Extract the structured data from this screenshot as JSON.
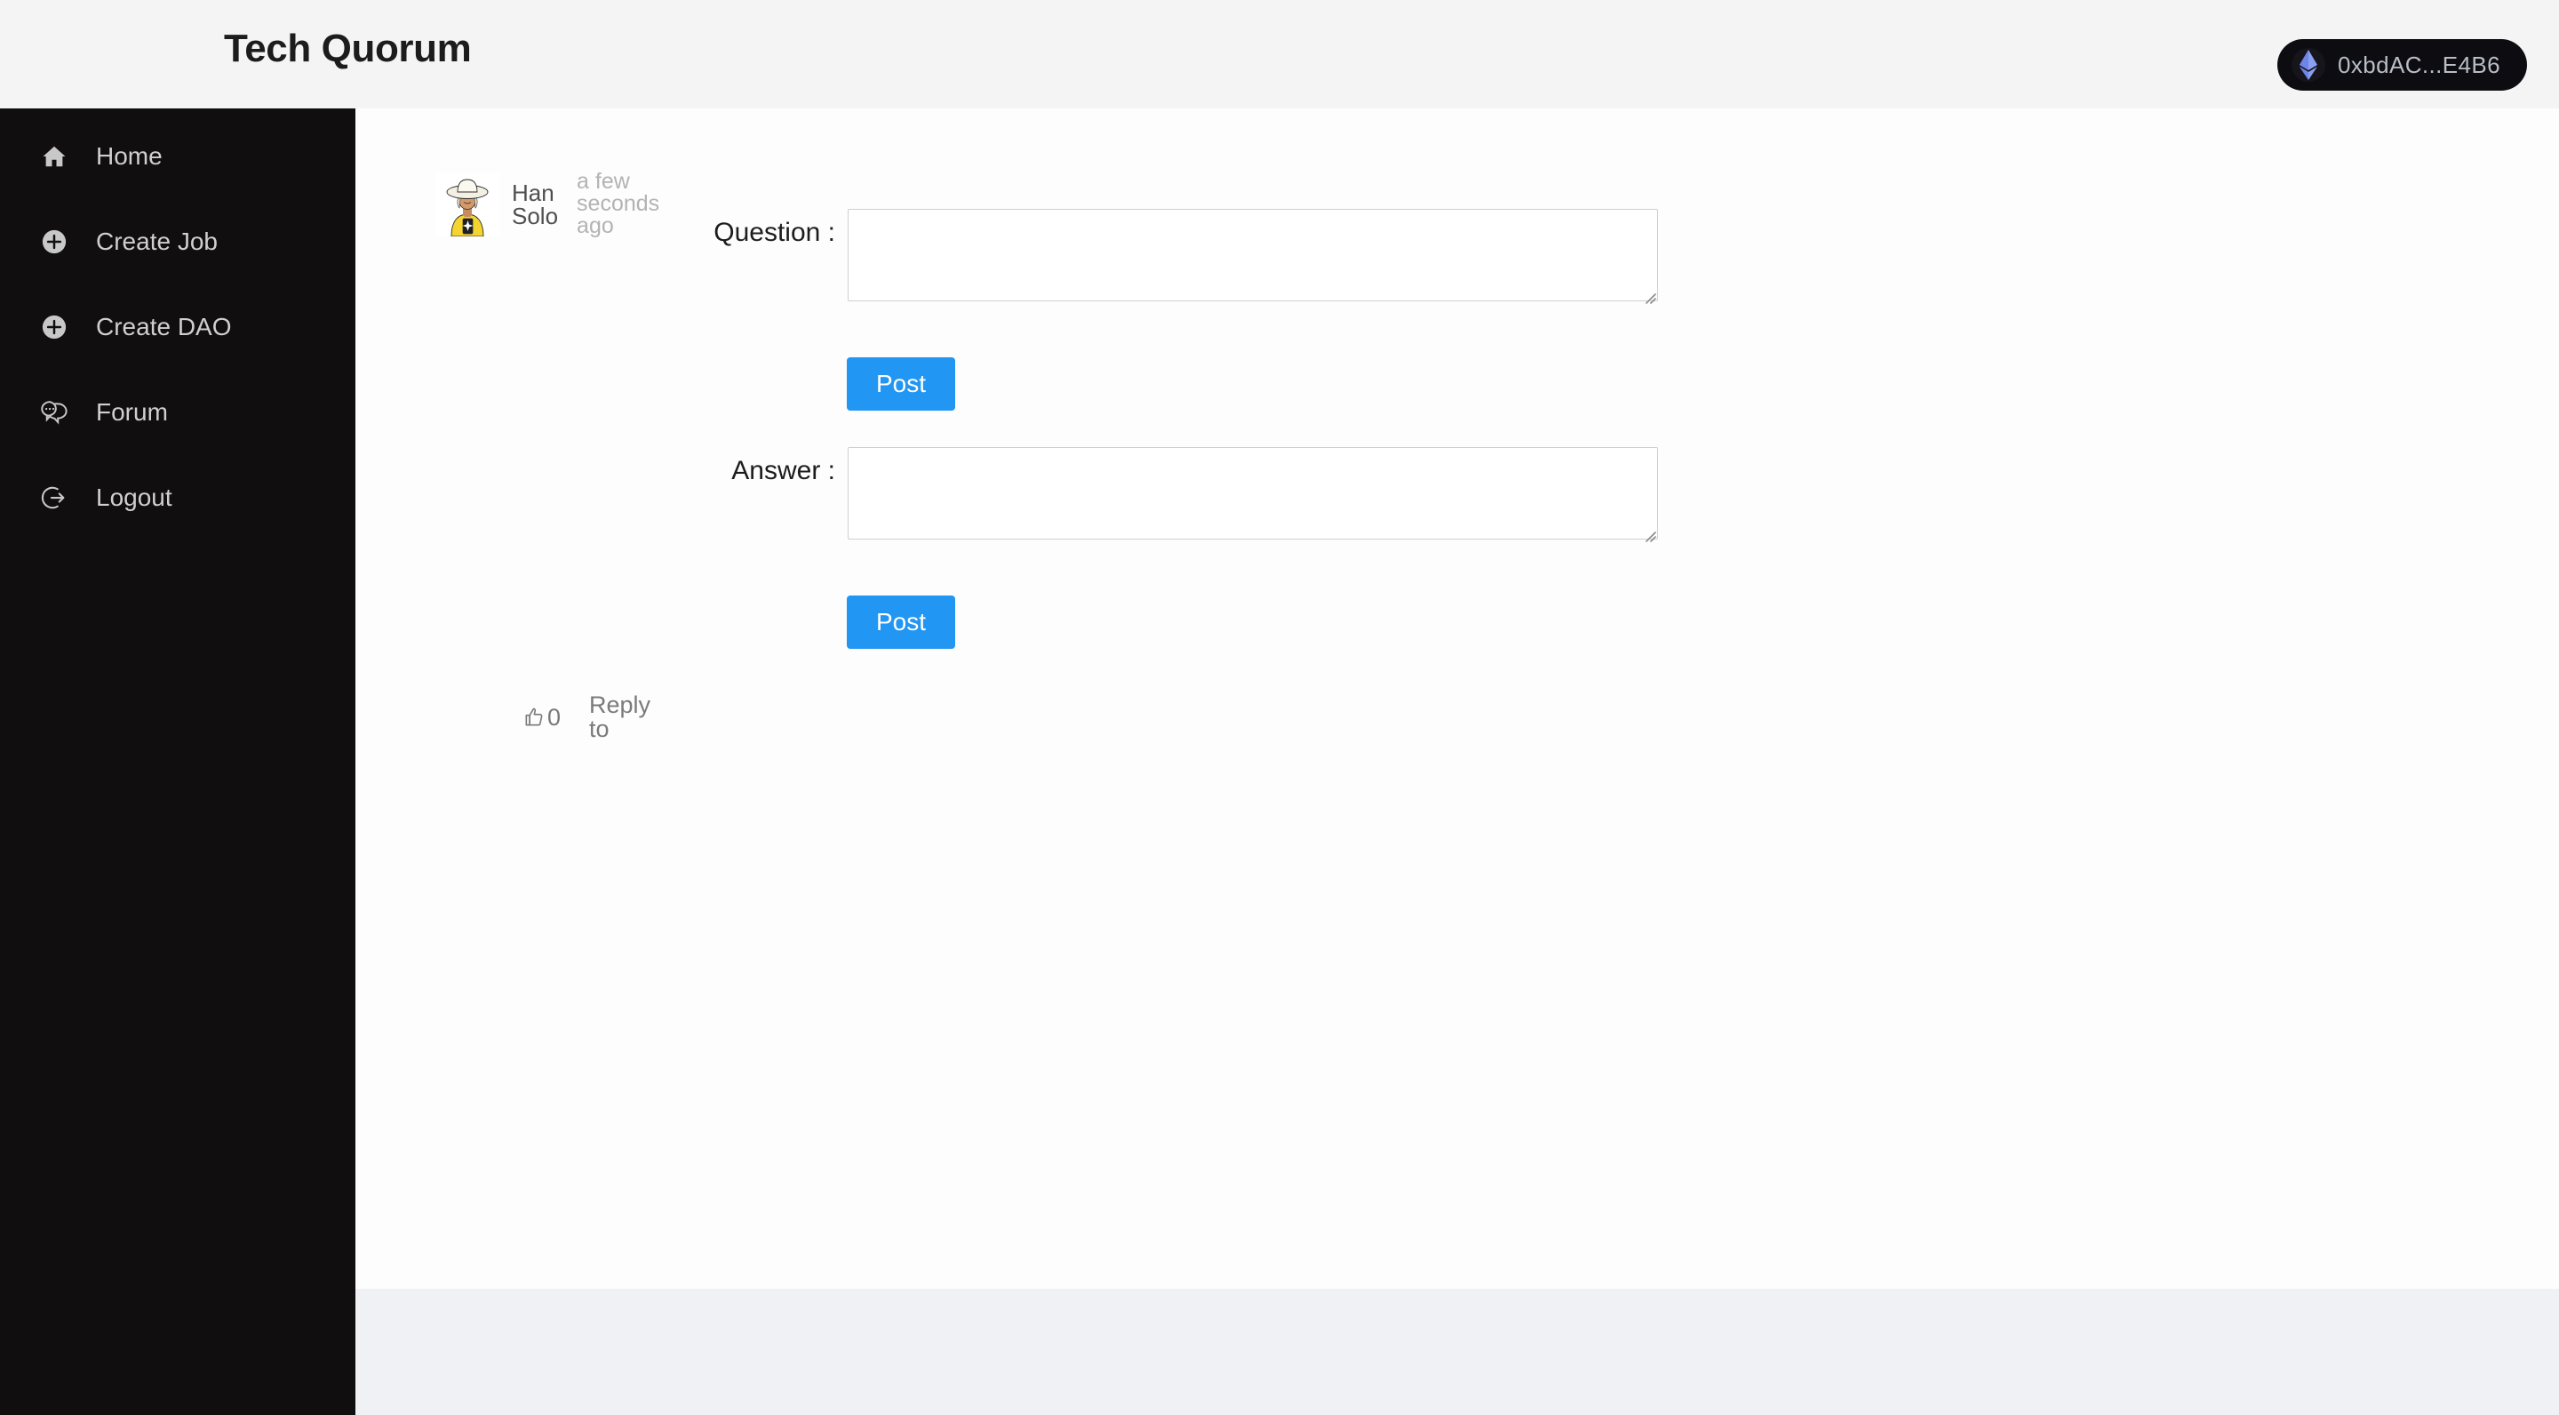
{
  "header": {
    "brand_title": "Tech Quorum",
    "wallet": {
      "address": "0xbdAC...E4B6",
      "icon": "ethereum-diamond-icon",
      "background_color": "#0d0d11",
      "text_color": "#b9bdc6"
    },
    "background_color": "#f4f4f4"
  },
  "sidebar": {
    "background_color": "#100e0e",
    "text_color": "#cfcfcf",
    "items": [
      {
        "label": "Home",
        "icon": "home-icon"
      },
      {
        "label": "Create Job",
        "icon": "plus-circle-icon"
      },
      {
        "label": "Create DAO",
        "icon": "plus-circle-icon"
      },
      {
        "label": "Forum",
        "icon": "chat-bubbles-icon"
      },
      {
        "label": "Logout",
        "icon": "logout-icon"
      }
    ]
  },
  "main": {
    "background_color": "#fdfdfd",
    "footer_color": "#eff1f5",
    "post": {
      "avatar_icon": "user-avatar-illustration",
      "author": "Han Solo",
      "timestamp": "a few seconds ago",
      "question": {
        "label": "Question :",
        "value": "",
        "placeholder": ""
      },
      "question_post_button": "Post",
      "answer": {
        "label": "Answer :",
        "value": "",
        "placeholder": ""
      },
      "answer_post_button": "Post",
      "actions": {
        "like_icon": "thumbs-up-icon",
        "like_count": "0",
        "reply_label": "Reply to"
      },
      "accent_color": "#2196f3"
    }
  }
}
